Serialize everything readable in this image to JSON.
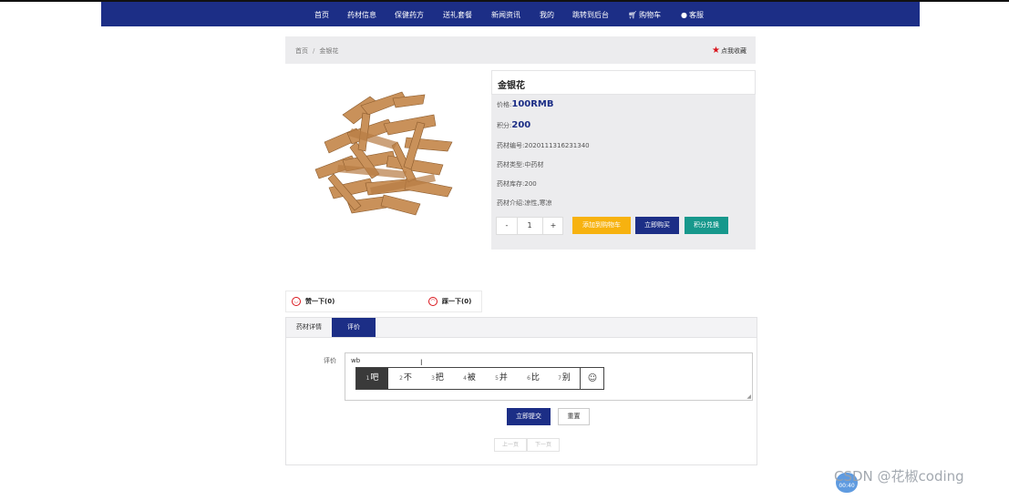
{
  "nav": {
    "items": [
      "首页",
      "药材信息",
      "保健药方",
      "送礼套餐",
      "新闻资讯",
      "我的",
      "跳转到后台",
      "购物车",
      "客服"
    ]
  },
  "breadcrumb": {
    "home": "首页",
    "separator": "/",
    "current": "金银花"
  },
  "favorite": {
    "label": "点我收藏",
    "star_color": "#d9141b"
  },
  "product": {
    "title": "金银花",
    "price_label": "价格:",
    "price_value": "100RMB",
    "points_label": "积分:",
    "points_value": "200",
    "code_label": "药材编号:",
    "code_value": "2020111316231340",
    "type_label": "药材类型:",
    "type_value": "中药材",
    "stock_label": "药材库存:",
    "stock_value": "200",
    "intro_label": "药材介绍:",
    "intro_value": "凉性,寒凉"
  },
  "quantity": {
    "minus": "-",
    "value": "1",
    "plus": "+"
  },
  "actions": {
    "add_cart": "添加到购物车",
    "buy_now": "立即购买",
    "points_redeem": "积分兑换"
  },
  "votes": {
    "like": "赞一下(0)",
    "dislike": "踩一下(0)"
  },
  "tabs": {
    "detail": "药材详情",
    "review": "评价"
  },
  "review_form": {
    "label": "评价",
    "text_value": "wb",
    "ime_candidates": [
      {
        "n": "1",
        "text": "吧"
      },
      {
        "n": "2",
        "text": "不"
      },
      {
        "n": "3",
        "text": "把"
      },
      {
        "n": "4",
        "text": "被"
      },
      {
        "n": "5",
        "text": "并"
      },
      {
        "n": "6",
        "text": "比"
      },
      {
        "n": "7",
        "text": "别"
      }
    ],
    "submit": "立即提交",
    "reset": "重置"
  },
  "pager": {
    "prev": "上一页",
    "next": "下一页"
  },
  "watermark": {
    "text": "CSDN @花椒coding",
    "badge": "00:40"
  },
  "colors": {
    "nav_bg": "#1c2e86",
    "cart_btn": "#f7b20f",
    "buy_btn": "#1c2e86",
    "points_btn": "#17988c",
    "panel_bg": "#ececee"
  }
}
